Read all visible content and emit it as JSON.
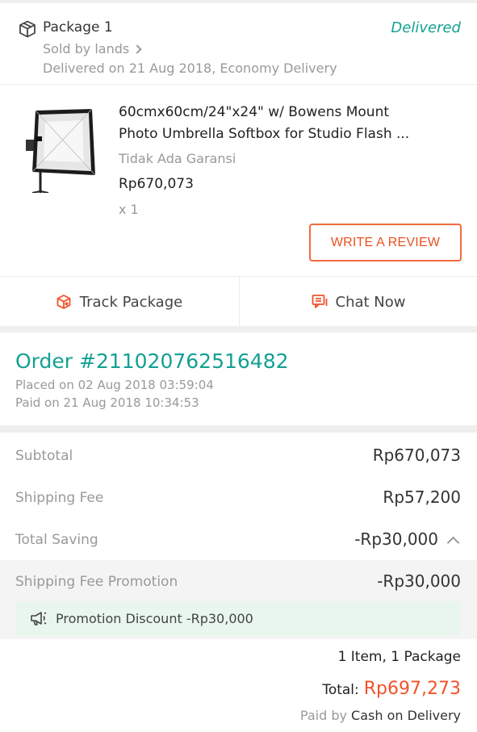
{
  "package": {
    "title": "Package 1",
    "status": "Delivered",
    "sold_by": "Sold by lands",
    "delivered_on": "Delivered on 21 Aug 2018, Economy Delivery"
  },
  "product": {
    "title_line1": "60cmx60cm/24\"x24\" w/ Bowens Mount",
    "title_line2": "Photo Umbrella Softbox for Studio Flash ...",
    "warranty": "Tidak Ada Garansi",
    "price": "Rp670,073",
    "qty": "x 1",
    "review_button": "WRITE A REVIEW"
  },
  "actions": {
    "track": "Track Package",
    "chat": "Chat Now"
  },
  "order": {
    "number": "Order #211020762516482",
    "placed": "Placed on 02 Aug 2018  03:59:04",
    "paid": "Paid on 21 Aug 2018  10:34:53"
  },
  "summary": {
    "subtotal_label": "Subtotal",
    "subtotal_value": "Rp670,073",
    "shipping_label": "Shipping Fee",
    "shipping_value": "Rp57,200",
    "saving_label": "Total Saving",
    "saving_value": "-Rp30,000",
    "promo_label": "Shipping Fee Promotion",
    "promo_value": "-Rp30,000",
    "discount_text": "Promotion Discount -Rp30,000",
    "items_count": "1 Item, 1 Package",
    "total_label": "Total:",
    "total_value": "Rp697,273",
    "paid_by_label": "Paid by",
    "paid_by_method": "Cash on Delivery"
  },
  "colors": {
    "accent_teal": "#14a193",
    "accent_orange": "#f1532a",
    "promo_bg": "#e8f6ee"
  },
  "icons": {
    "package": "package-box-icon",
    "sold_by": "chevron-right-icon",
    "track": "track-package-icon",
    "chat": "chat-icon",
    "saving_toggle": "chevron-up-icon",
    "discount": "megaphone-icon"
  }
}
